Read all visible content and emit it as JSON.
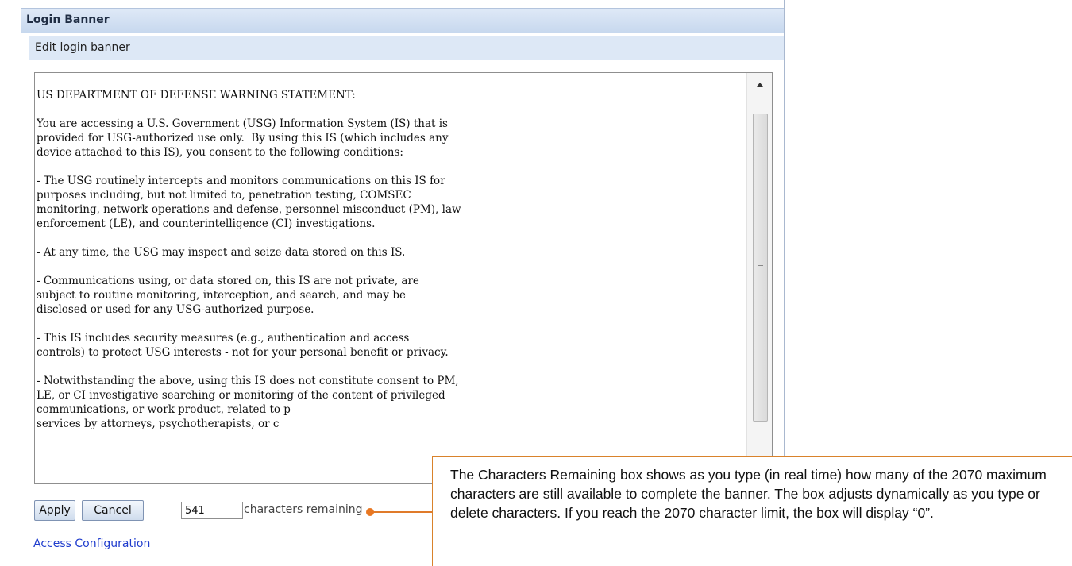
{
  "header": {
    "title": "Login Banner",
    "subtitle": "Edit login banner"
  },
  "banner_text": "US DEPARTMENT OF DEFENSE WARNING STATEMENT:\n\nYou are accessing a U.S. Government (USG) Information System (IS) that is\nprovided for USG-authorized use only.  By using this IS (which includes any\ndevice attached to this IS), you consent to the following conditions:\n\n- The USG routinely intercepts and monitors communications on this IS for\npurposes including, but not limited to, penetration testing, COMSEC\nmonitoring, network operations and defense, personnel misconduct (PM), law\nenforcement (LE), and counterintelligence (CI) investigations.\n\n- At any time, the USG may inspect and seize data stored on this IS.\n\n- Communications using, or data stored on, this IS are not private, are\nsubject to routine monitoring, interception, and search, and may be\ndisclosed or used for any USG-authorized purpose.\n\n- This IS includes security measures (e.g., authentication and access\ncontrols) to protect USG interests - not for your personal benefit or privacy.\n\n- Notwithstanding the above, using this IS does not constitute consent to PM,\nLE, or CI investigative searching or monitoring of the content of privileged\ncommunications, or work product, related to p\nservices by attorneys, psychotherapists, or c",
  "buttons": {
    "apply": "Apply",
    "cancel": "Cancel"
  },
  "characters": {
    "remaining_value": "541",
    "label": "characters remaining"
  },
  "links": {
    "access_configuration": "Access Configuration"
  },
  "callout": {
    "text": "The Characters Remaining box shows as you type (in real time) how many of the 2070 maximum characters are still available to complete the banner. The box adjusts dynamically as you type or delete characters. If you reach the 2070 character limit, the box will display “0”."
  },
  "colors": {
    "accent_orange": "#e87722",
    "link_blue": "#1f3ccd",
    "header_blue": "#c7d8ee"
  }
}
